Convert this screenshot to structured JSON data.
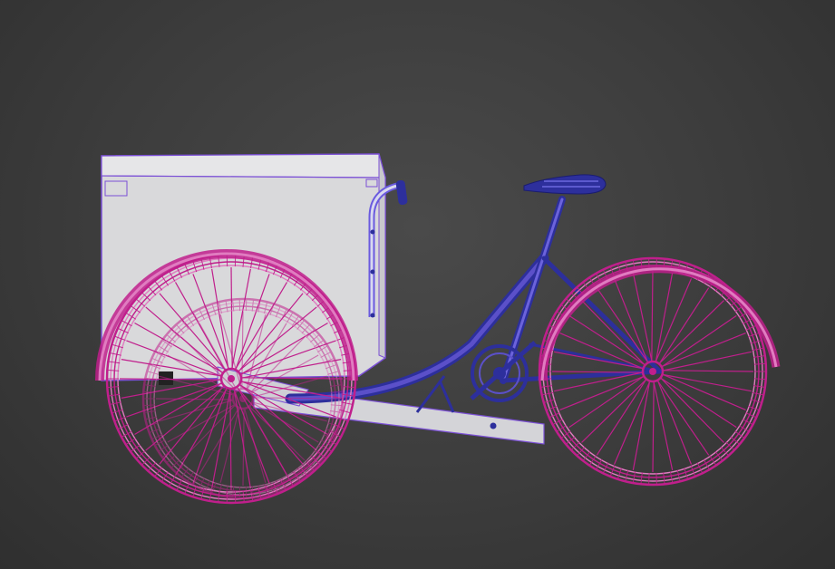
{
  "scene": {
    "subject": "cargo-tricycle-wireframe",
    "colors": {
      "background": "#3c3c3c",
      "box_fill": "#d8d8d8",
      "box_wire": "#7b4fd6",
      "wheel_wire": "#c01f8c",
      "wheel_wire_light": "#e07cc0",
      "frame_wire": "#2d2f9c",
      "frame_light": "#6a5adf"
    }
  }
}
